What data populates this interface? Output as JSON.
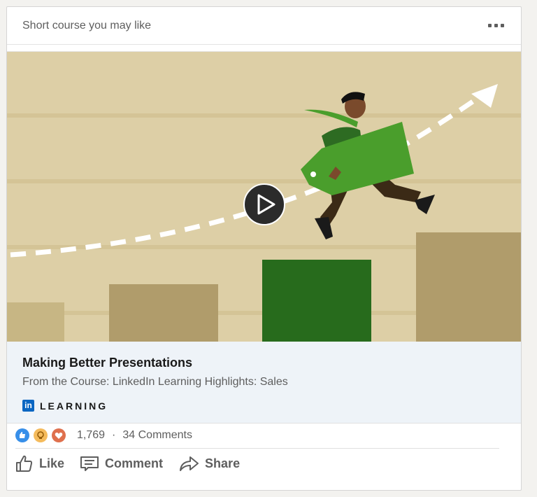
{
  "header": {
    "title": "Short course you may like",
    "more_icon": "ellipsis-icon"
  },
  "video": {
    "play_icon": "play-icon"
  },
  "course": {
    "title": "Making Better Presentations",
    "subtitle": "From the Course: LinkedIn Learning Highlights: Sales",
    "brand_logo": "in",
    "brand_label": "LEARNING"
  },
  "social": {
    "reactions": [
      "like-reaction-icon",
      "insightful-reaction-icon",
      "love-reaction-icon"
    ],
    "count": "1,769",
    "separator": "·",
    "comments": "34 Comments"
  },
  "actions": [
    {
      "label": "Like",
      "icon": "thumbs-up-icon"
    },
    {
      "label": "Comment",
      "icon": "comment-icon"
    },
    {
      "label": "Share",
      "icon": "share-arrow-icon"
    }
  ],
  "colors": {
    "background": "#ddcfa6",
    "bar_light": "#c7b684",
    "bar_mid": "#b09c6b",
    "bar_green": "#276b1c",
    "tag_green": "#4a9e2c",
    "linkedin_blue": "#0a66c2"
  }
}
